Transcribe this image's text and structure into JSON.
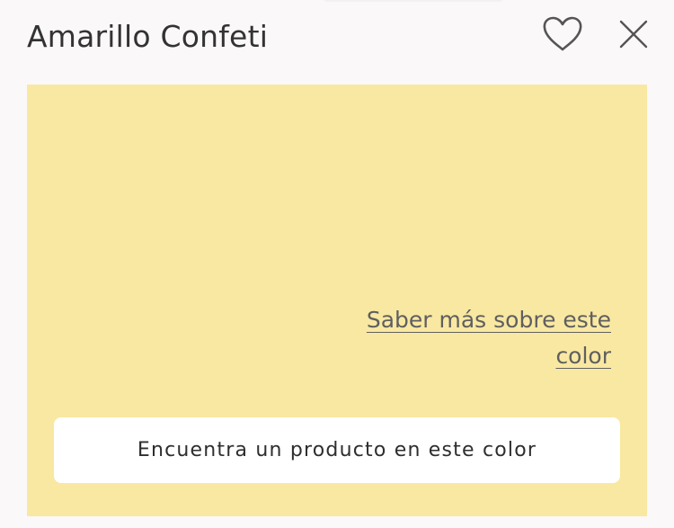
{
  "modal": {
    "title": "Amarillo Confeti",
    "icons": {
      "favorite": "heart-outline-icon",
      "close": "close-x-icon"
    }
  },
  "swatch": {
    "color": "#f9e8a2",
    "learn_more_label": "Saber más sobre este color",
    "find_product_label": "Encuentra un producto en este color"
  },
  "colors": {
    "background": "#fbf8f9",
    "text": "#333333",
    "icon": "#555555",
    "button_background": "#ffffff"
  }
}
